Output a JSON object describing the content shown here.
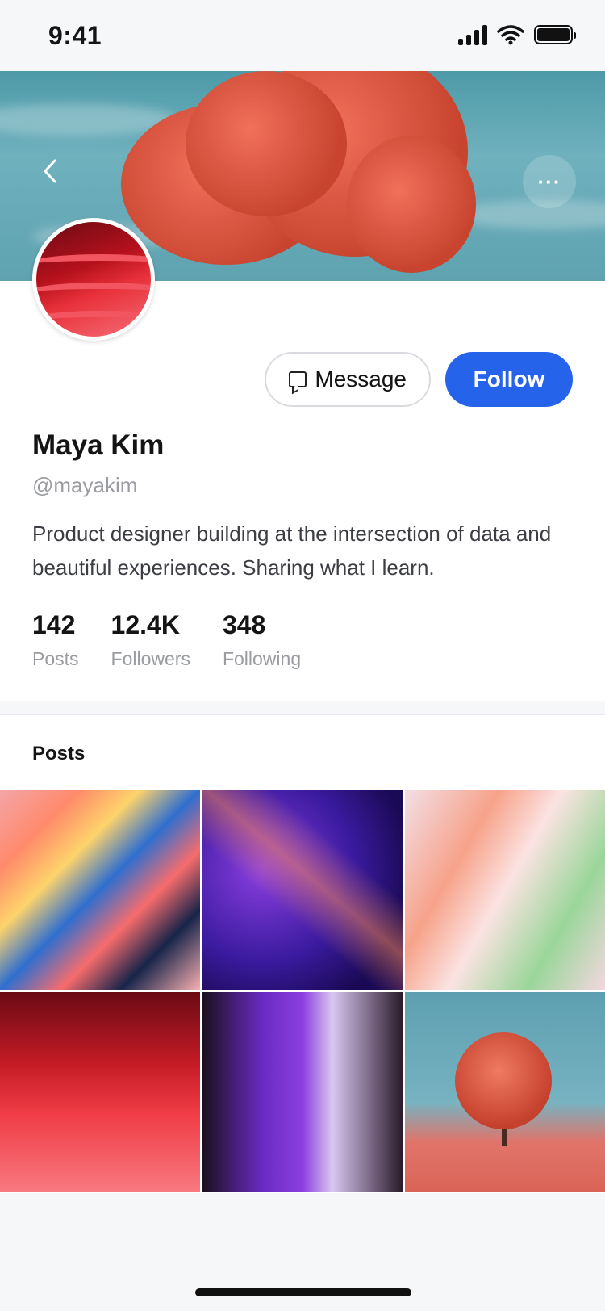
{
  "status_bar": {
    "time": "9:41"
  },
  "header": {
    "back_icon": "chevron-left-icon",
    "more_icon": "more-horizontal-icon",
    "more_label": "···"
  },
  "profile": {
    "name": "Maya Kim",
    "handle": "@mayakim",
    "bio": "Product designer building at the intersection of data and beautiful experiences. Sharing what I learn.",
    "message_label": "Message",
    "follow_label": "Follow",
    "accent_color": "#2563eb",
    "stats": [
      {
        "value": "142",
        "label": "Posts"
      },
      {
        "value": "12.4K",
        "label": "Followers"
      },
      {
        "value": "348",
        "label": "Following"
      }
    ]
  },
  "posts": {
    "title": "Posts"
  }
}
